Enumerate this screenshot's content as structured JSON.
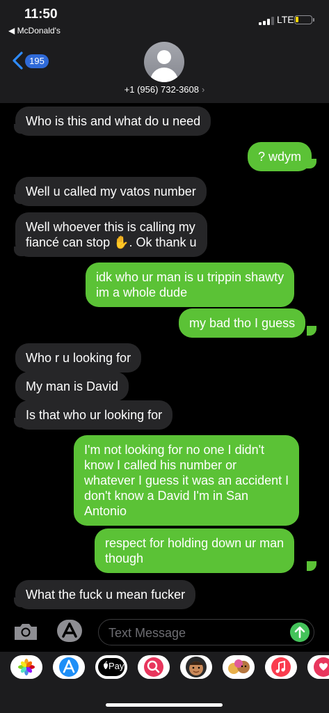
{
  "status_bar": {
    "time": "11:50",
    "back_app": "◀ McDonald's",
    "network": "LTE"
  },
  "header": {
    "unread_count": "195",
    "contact_number": "+1 (956) 732-3608",
    "chevron": "›"
  },
  "messages": [
    {
      "direction": "incoming",
      "lines": [
        "Who is this and what do u need"
      ]
    },
    {
      "direction": "outgoing",
      "lines": [
        "? wdym"
      ]
    },
    {
      "direction": "incoming",
      "lines": [
        "Well u called my vatos number"
      ]
    },
    {
      "direction": "incoming",
      "lines": [
        "Well whoever this is calling my",
        "fiancé can stop ✋. Ok thank u"
      ]
    },
    {
      "direction": "outgoing",
      "lines": [
        "idk who ur man is u trippin shawty",
        "im a whole dude"
      ]
    },
    {
      "direction": "outgoing",
      "lines": [
        "my bad tho I guess"
      ]
    },
    {
      "direction": "incoming",
      "lines": [
        "Who r u looking for"
      ]
    },
    {
      "direction": "incoming",
      "lines": [
        "My man is David"
      ]
    },
    {
      "direction": "incoming",
      "lines": [
        "Is that who ur looking for"
      ]
    },
    {
      "direction": "outgoing",
      "lines": [
        "I'm not looking for no one I didn't",
        "know I called his number or",
        "whatever I guess it was an accident I",
        "don't know a David I'm in San",
        "Antonio"
      ]
    },
    {
      "direction": "outgoing",
      "lines": [
        "respect for holding down ur man",
        "though"
      ]
    },
    {
      "direction": "incoming",
      "lines": [
        "What the fuck u mean  fucker"
      ]
    }
  ],
  "input": {
    "placeholder": "Text Message"
  },
  "app_drawer": {
    "apps": [
      {
        "name": "photos-app-icon"
      },
      {
        "name": "app-store-icon"
      },
      {
        "name": "apple-pay-icon",
        "label": "Pay"
      },
      {
        "name": "web-search-icon"
      },
      {
        "name": "memoji-icon"
      },
      {
        "name": "animoji-icon"
      },
      {
        "name": "music-icon"
      },
      {
        "name": "digital-touch-icon"
      }
    ]
  },
  "colors": {
    "incoming_bubble": "#262628",
    "outgoing_bubble": "#5bc236",
    "badge": "#2f6ad8",
    "link_blue": "#2f8cff",
    "send_button": "#44c35a"
  }
}
